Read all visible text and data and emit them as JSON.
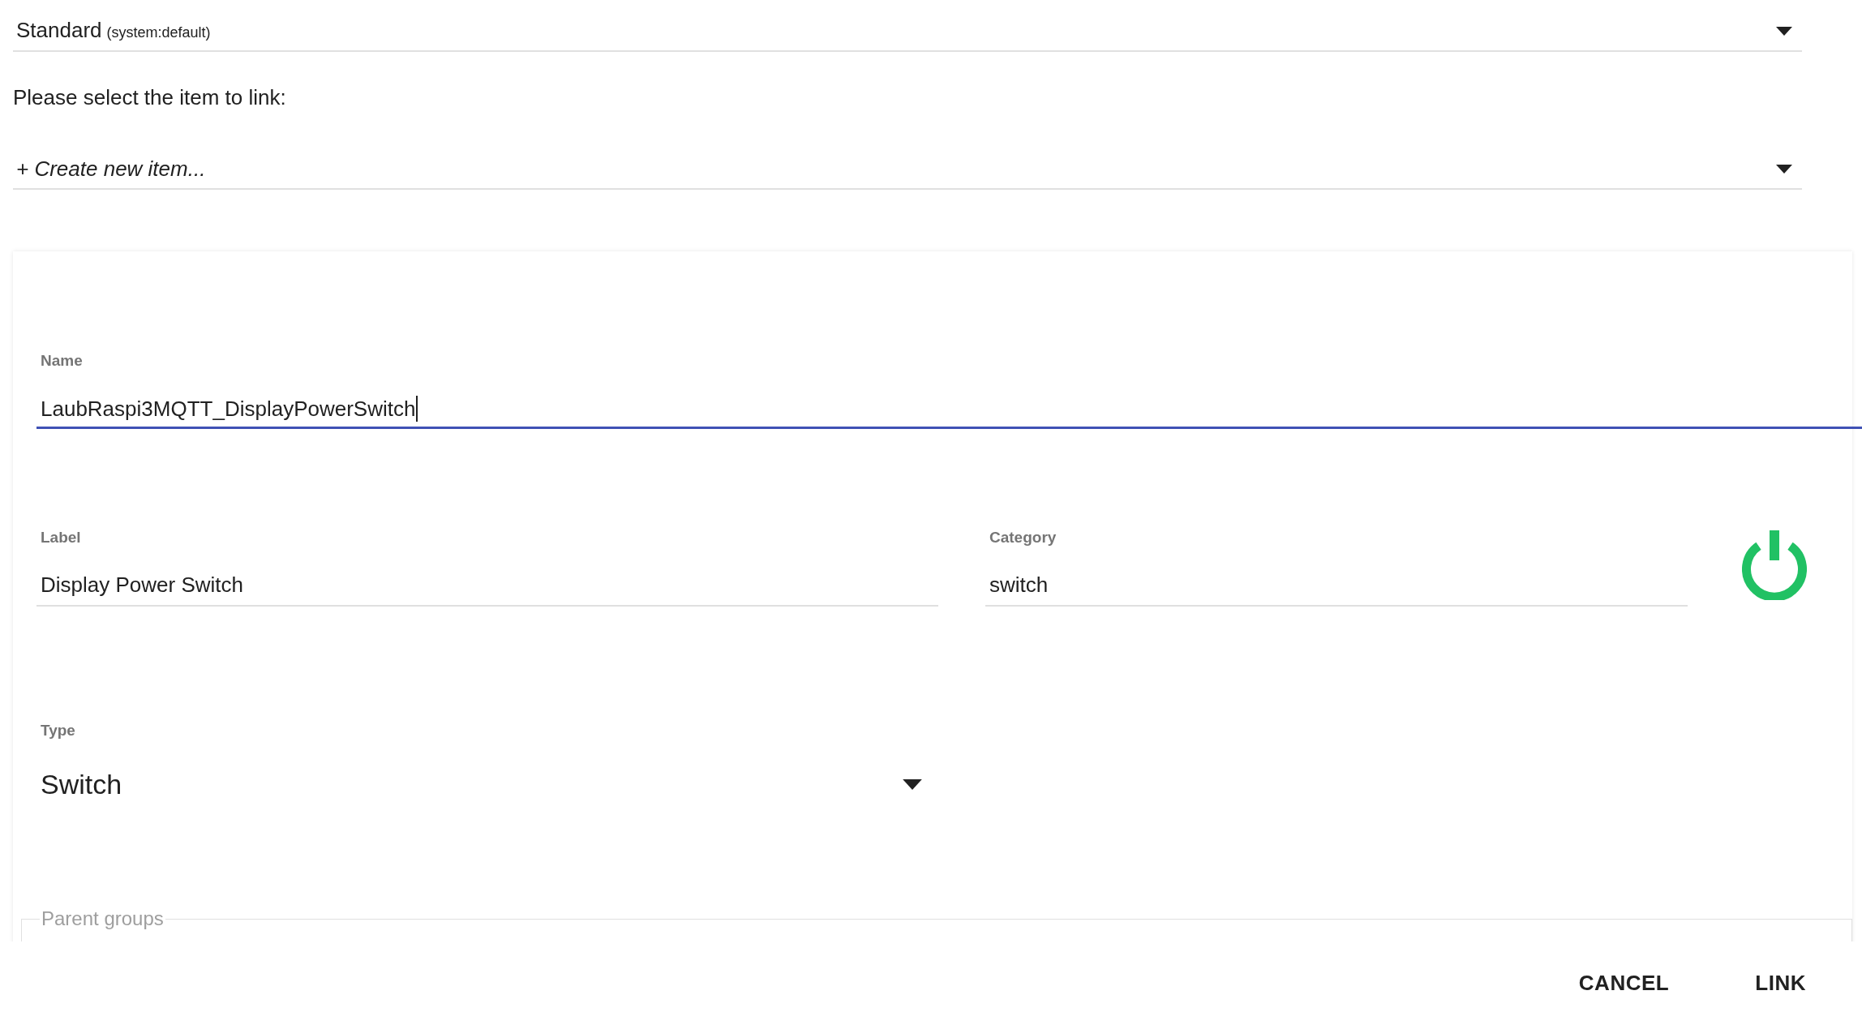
{
  "profile_select": {
    "value": "Standard",
    "hint": "(system:default)"
  },
  "prompt": "Please select the item to link:",
  "item_select": {
    "value": "+ Create new item..."
  },
  "item_form": {
    "name": {
      "label": "Name",
      "value": "LaubRaspi3MQTT_DisplayPowerSwitch",
      "focused": true
    },
    "label": {
      "label": "Label",
      "value": "Display Power Switch",
      "focused": false
    },
    "category": {
      "label": "Category",
      "value": "switch",
      "focused": false
    },
    "type": {
      "label": "Type",
      "value": "Switch"
    },
    "parent_groups": {
      "legend": "Parent groups"
    }
  },
  "actions": [
    {
      "label": "CANCEL"
    },
    {
      "label": "LINK"
    }
  ]
}
